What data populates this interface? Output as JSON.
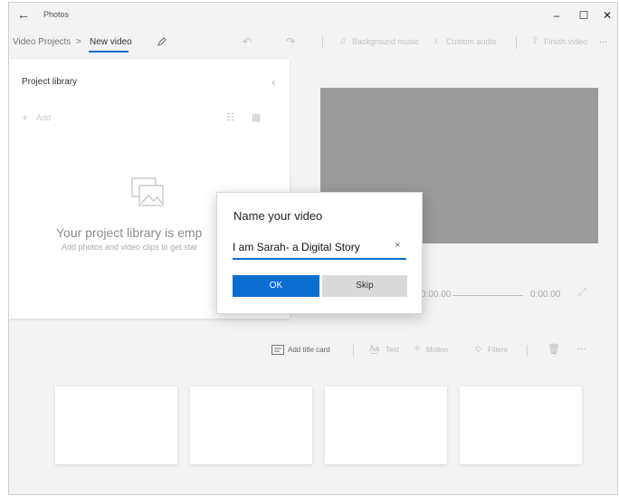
{
  "app": {
    "title": "Photos"
  },
  "window_controls": {
    "minimize": "–",
    "maximize": "☐",
    "close": "✕"
  },
  "breadcrumb": {
    "parent": "Video Projects",
    "separator": ">",
    "current": "New video"
  },
  "toolbar": {
    "background_music": "Background music",
    "custom_audio": "Custom audio",
    "finish_video": "Finish video",
    "more": "···"
  },
  "library": {
    "title": "Project library",
    "add_label": "Add",
    "empty_title": "Your project library is emp",
    "empty_subtitle": "Add photos and video clips to get star"
  },
  "preview": {
    "current_time": "0:00.00",
    "total_time": "0:00.00"
  },
  "storyboard": {
    "add_title_card": "Add title card",
    "text": "Text",
    "motion": "Motion",
    "filters": "Filters",
    "more": "···"
  },
  "dialog": {
    "title": "Name your video",
    "input_value": "I am Sarah- a Digital Story",
    "clear_icon": "×",
    "ok_label": "OK",
    "skip_label": "Skip"
  },
  "colors": {
    "accent": "#0a6ed1",
    "preview_bg": "#9a9a9a"
  }
}
